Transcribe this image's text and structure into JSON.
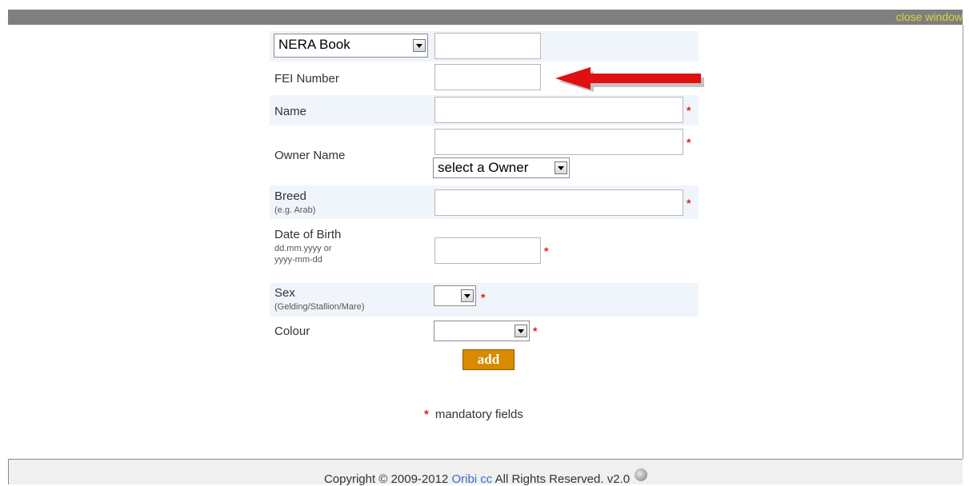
{
  "header": {
    "close_label": "close window"
  },
  "form": {
    "book_select": {
      "value": "NERA Book"
    },
    "fei": {
      "label": "FEI Number",
      "value": ""
    },
    "name": {
      "label": "Name",
      "value": ""
    },
    "owner": {
      "label": "Owner Name",
      "value": "",
      "select_value": "select a Owner"
    },
    "breed": {
      "label": "Breed",
      "hint": "(e.g. Arab)",
      "value": ""
    },
    "dob": {
      "label": "Date of Birth",
      "hint1": "dd.mm.yyyy or",
      "hint2": "yyyy-mm-dd",
      "value": ""
    },
    "sex": {
      "label": "Sex",
      "hint": "(Gelding/Stallion/Mare)",
      "value": ""
    },
    "colour": {
      "label": "Colour",
      "value": ""
    },
    "required_mark": "*",
    "add_label": "add"
  },
  "mandatory_note": {
    "star": "*",
    "text": "mandatory fields"
  },
  "footer": {
    "text_before": "Copyright © 2009-2012 ",
    "link": "Oribi cc",
    "text_after": " All Rights Reserved. v2.0"
  },
  "colors": {
    "accent_button": "#d98a00",
    "required": "#e02020",
    "arrow": "#e01010",
    "link": "#3a6bc9"
  },
  "icons": {
    "pointer_arrow": "red-arrow-icon",
    "globe": "globe-icon",
    "dropdown": "chevron-down-icon"
  }
}
